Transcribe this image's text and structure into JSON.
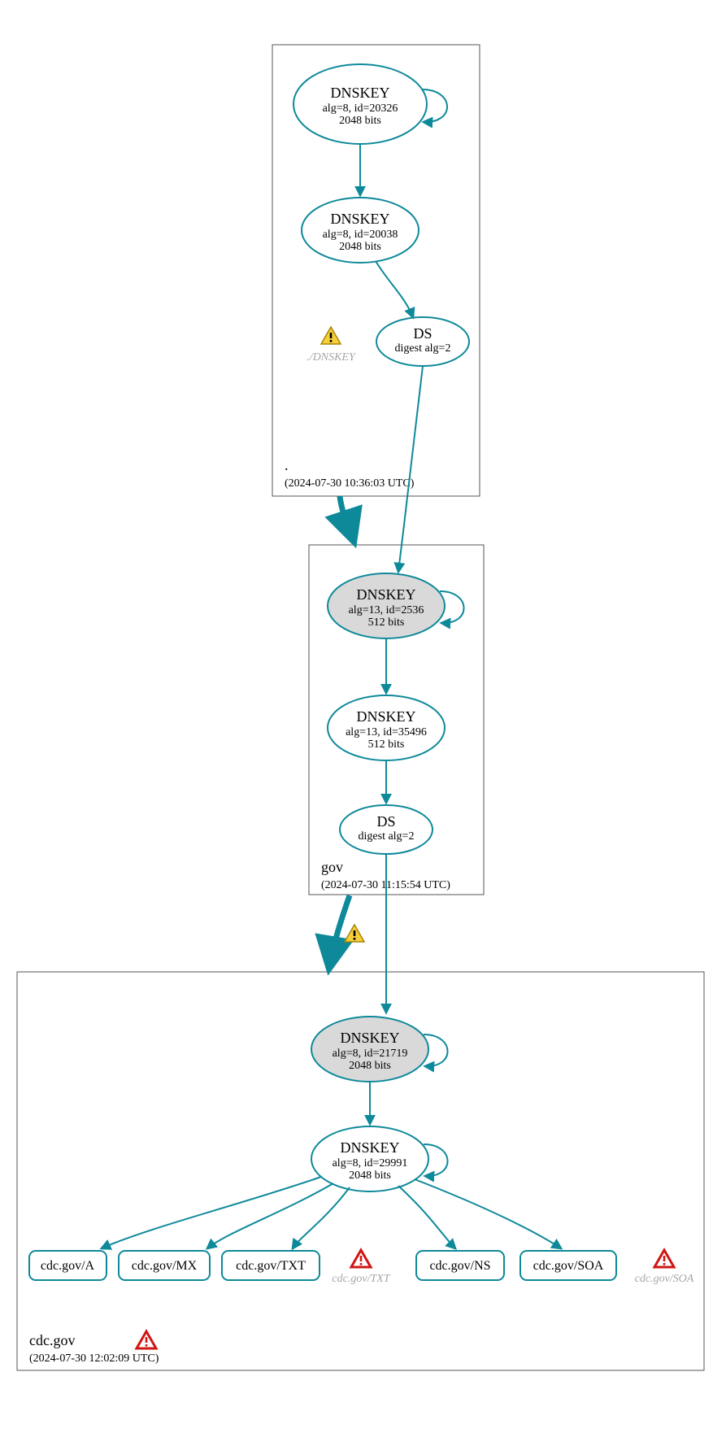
{
  "zones": {
    "root": {
      "label": ".",
      "timestamp": "(2024-07-30 10:36:03 UTC)"
    },
    "gov": {
      "label": "gov",
      "timestamp": "(2024-07-30 11:15:54 UTC)"
    },
    "cdc": {
      "label": "cdc.gov",
      "timestamp": "(2024-07-30 12:02:09 UTC)"
    }
  },
  "nodes": {
    "root_ksk": {
      "title": "DNSKEY",
      "line2": "alg=8, id=20326",
      "line3": "2048 bits"
    },
    "root_zsk": {
      "title": "DNSKEY",
      "line2": "alg=8, id=20038",
      "line3": "2048 bits"
    },
    "root_ds": {
      "title": "DS",
      "line2": "digest alg=2"
    },
    "root_ghost_dnskey": {
      "label": "./DNSKEY"
    },
    "gov_ksk": {
      "title": "DNSKEY",
      "line2": "alg=13, id=2536",
      "line3": "512 bits"
    },
    "gov_zsk": {
      "title": "DNSKEY",
      "line2": "alg=13, id=35496",
      "line3": "512 bits"
    },
    "gov_ds": {
      "title": "DS",
      "line2": "digest alg=2"
    },
    "cdc_ksk": {
      "title": "DNSKEY",
      "line2": "alg=8, id=21719",
      "line3": "2048 bits"
    },
    "cdc_zsk": {
      "title": "DNSKEY",
      "line2": "alg=8, id=29991",
      "line3": "2048 bits"
    },
    "cdc_ghost_txt": {
      "label": "cdc.gov/TXT"
    },
    "cdc_ghost_soa": {
      "label": "cdc.gov/SOA"
    }
  },
  "rr": {
    "a": "cdc.gov/A",
    "mx": "cdc.gov/MX",
    "txt": "cdc.gov/TXT",
    "ns": "cdc.gov/NS",
    "soa": "cdc.gov/SOA"
  }
}
